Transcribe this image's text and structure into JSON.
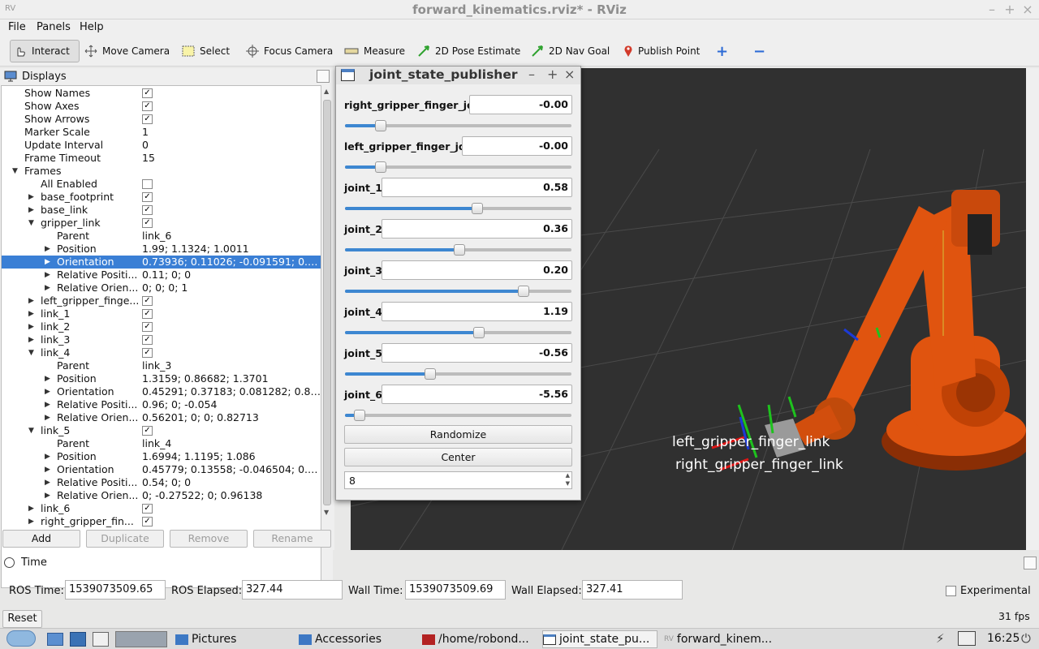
{
  "window": {
    "title": "forward_kinematics.rviz* - RViz",
    "icon": "rviz-logo-icon"
  },
  "menu": [
    "File",
    "Panels",
    "Help"
  ],
  "toolbar": {
    "interact": "Interact",
    "move_camera": "Move Camera",
    "select": "Select",
    "focus_camera": "Focus Camera",
    "measure": "Measure",
    "pose_estimate": "2D Pose Estimate",
    "nav_goal": "2D Nav Goal",
    "publish_point": "Publish Point"
  },
  "displays": {
    "title": "Displays",
    "rows": [
      {
        "label": "Show Names",
        "check": true
      },
      {
        "label": "Show Axes",
        "check": true
      },
      {
        "label": "Show Arrows",
        "check": true
      },
      {
        "label": "Marker Scale",
        "value": "1"
      },
      {
        "label": "Update Interval",
        "value": "0"
      },
      {
        "label": "Frame Timeout",
        "value": "15"
      },
      {
        "label": "Frames",
        "expand": "open"
      },
      {
        "label": "All Enabled",
        "check": false
      },
      {
        "label": "base_footprint",
        "check": true,
        "expand": "closed"
      },
      {
        "label": "base_link",
        "check": true,
        "expand": "closed"
      },
      {
        "label": "gripper_link",
        "check": true,
        "expand": "open"
      },
      {
        "label": "Parent",
        "value": "link_6"
      },
      {
        "label": "Position",
        "value": "1.99; 1.1324; 1.0011",
        "expand": "closed"
      },
      {
        "label": "Orientation",
        "value": "0.73936; 0.11026; -0.091591; 0.6...",
        "expand": "closed",
        "selected": true
      },
      {
        "label": "Relative Positi...",
        "value": "0.11; 0; 0",
        "expand": "closed"
      },
      {
        "label": "Relative Orien...",
        "value": "0; 0; 0; 1",
        "expand": "closed"
      },
      {
        "label": "left_gripper_finge...",
        "check": true,
        "expand": "closed"
      },
      {
        "label": "link_1",
        "check": true,
        "expand": "closed"
      },
      {
        "label": "link_2",
        "check": true,
        "expand": "closed"
      },
      {
        "label": "link_3",
        "check": true,
        "expand": "closed"
      },
      {
        "label": "link_4",
        "check": true,
        "expand": "open"
      },
      {
        "label": "Parent",
        "value": "link_3"
      },
      {
        "label": "Position",
        "value": "1.3159; 0.86682; 1.3701",
        "expand": "closed"
      },
      {
        "label": "Orientation",
        "value": "0.45291; 0.37183; 0.081282; 0.80...",
        "expand": "closed"
      },
      {
        "label": "Relative Positi...",
        "value": "0.96; 0; -0.054",
        "expand": "closed"
      },
      {
        "label": "Relative Orien...",
        "value": "0.56201; 0; 0; 0.82713",
        "expand": "closed"
      },
      {
        "label": "link_5",
        "check": true,
        "expand": "open"
      },
      {
        "label": "Parent",
        "value": "link_4"
      },
      {
        "label": "Position",
        "value": "1.6994; 1.1195; 1.086",
        "expand": "closed"
      },
      {
        "label": "Orientation",
        "value": "0.45779; 0.13558; -0.046504; 0.8...",
        "expand": "closed"
      },
      {
        "label": "Relative Positi...",
        "value": "0.54; 0; 0",
        "expand": "closed"
      },
      {
        "label": "Relative Orien...",
        "value": "0; -0.27522; 0; 0.96138",
        "expand": "closed"
      },
      {
        "label": "link_6",
        "check": true,
        "expand": "closed"
      },
      {
        "label": "right_gripper_fin...",
        "check": true,
        "expand": "closed"
      }
    ],
    "buttons": {
      "add": "Add",
      "duplicate": "Duplicate",
      "remove": "Remove",
      "rename": "Rename"
    }
  },
  "joint_state_publisher": {
    "title": "joint_state_publisher",
    "joints": [
      {
        "name": "right_gripper_finger_joint",
        "value": "-0.00",
        "fraction": 0.158
      },
      {
        "name": "left_gripper_finger_joint",
        "value": "-0.00",
        "fraction": 0.158
      },
      {
        "name": "joint_1",
        "value": "0.58",
        "fraction": 0.585
      },
      {
        "name": "joint_2",
        "value": "0.36",
        "fraction": 0.505
      },
      {
        "name": "joint_3",
        "value": "0.20",
        "fraction": 0.79
      },
      {
        "name": "joint_4",
        "value": "1.19",
        "fraction": 0.593
      },
      {
        "name": "joint_5",
        "value": "-0.56",
        "fraction": 0.378
      },
      {
        "name": "joint_6",
        "value": "-5.56",
        "fraction": 0.065
      }
    ],
    "randomize": "Randomize",
    "center": "Center",
    "spin_value": "8"
  },
  "viewport": {
    "labels": [
      "left_gripper_finger_link",
      "right_gripper_finger_link"
    ],
    "robot_color": "#e0540f",
    "background": "#303030"
  },
  "time": {
    "title": "Time",
    "ros_time_label": "ROS Time:",
    "ros_time": "1539073509.65",
    "ros_elapsed_label": "ROS Elapsed:",
    "ros_elapsed": "327.44",
    "wall_time_label": "Wall Time:",
    "wall_time": "1539073509.69",
    "wall_elapsed_label": "Wall Elapsed:",
    "wall_elapsed": "327.41",
    "experimental": "Experimental",
    "reset": "Reset",
    "fps": "31 fps"
  },
  "taskbar": {
    "tasks": [
      "Pictures",
      "Accessories",
      "/home/robond...",
      "joint_state_pu...",
      "forward_kinem..."
    ],
    "clock": "16:25"
  }
}
